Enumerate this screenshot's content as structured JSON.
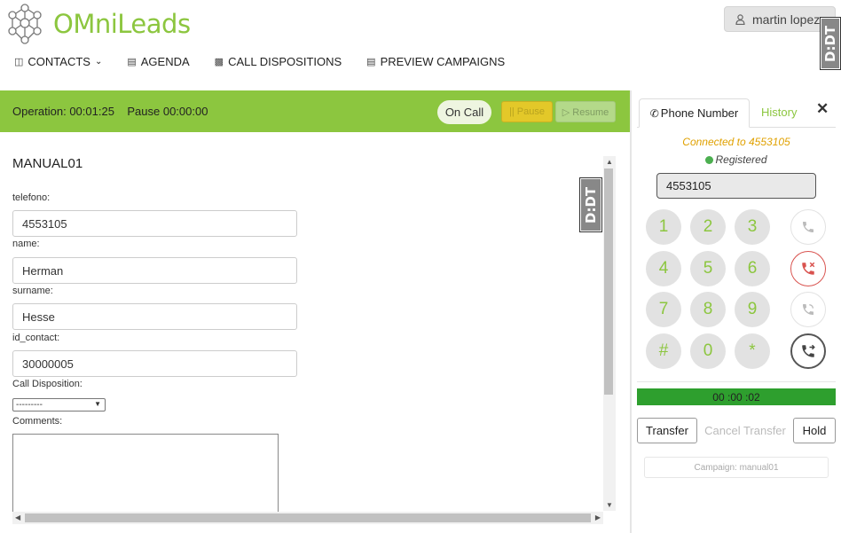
{
  "brand": {
    "name": "OMniLeads",
    "accent": "#8cc63f"
  },
  "user": {
    "name": "martin lopez",
    "icon": "user-icon"
  },
  "badge": {
    "text": "D:DT"
  },
  "nav": [
    {
      "label": "CONTACTS",
      "icon": "contacts-icon",
      "has_dropdown": true
    },
    {
      "label": "AGENDA",
      "icon": "agenda-icon"
    },
    {
      "label": "CALL DISPOSITIONS",
      "icon": "dispositions-icon"
    },
    {
      "label": "PREVIEW CAMPAIGNS",
      "icon": "preview-icon"
    }
  ],
  "status": {
    "operation_label": "Operation: 00:01:25",
    "pause_label": "Pause 00:00:00",
    "state": "On Call",
    "pause_button": "|| Pause",
    "resume_button": "▷ Resume"
  },
  "form": {
    "title": "MANUAL01",
    "fields": [
      {
        "label": "telefono:",
        "value": "4553105"
      },
      {
        "label": "name:",
        "value": "Herman"
      },
      {
        "label": "surname:",
        "value": "Hesse"
      },
      {
        "label": "id_contact:",
        "value": "30000005"
      }
    ],
    "disposition_label": "Call Disposition:",
    "disposition_value": "---------",
    "comments_label": "Comments:"
  },
  "phone": {
    "tab_phone": "Phone Number",
    "tab_history": "History",
    "connected": "Connected to 4553105",
    "registered": "Registered",
    "number": "4553105",
    "keys": [
      "1",
      "2",
      "3",
      "4",
      "5",
      "6",
      "7",
      "8",
      "9",
      "#",
      "0",
      "*"
    ],
    "timer": "00 :00 :02",
    "transfer": "Transfer",
    "cancel_transfer": "Cancel Transfer",
    "hold": "Hold",
    "campaign": "Campaign: manual01"
  }
}
